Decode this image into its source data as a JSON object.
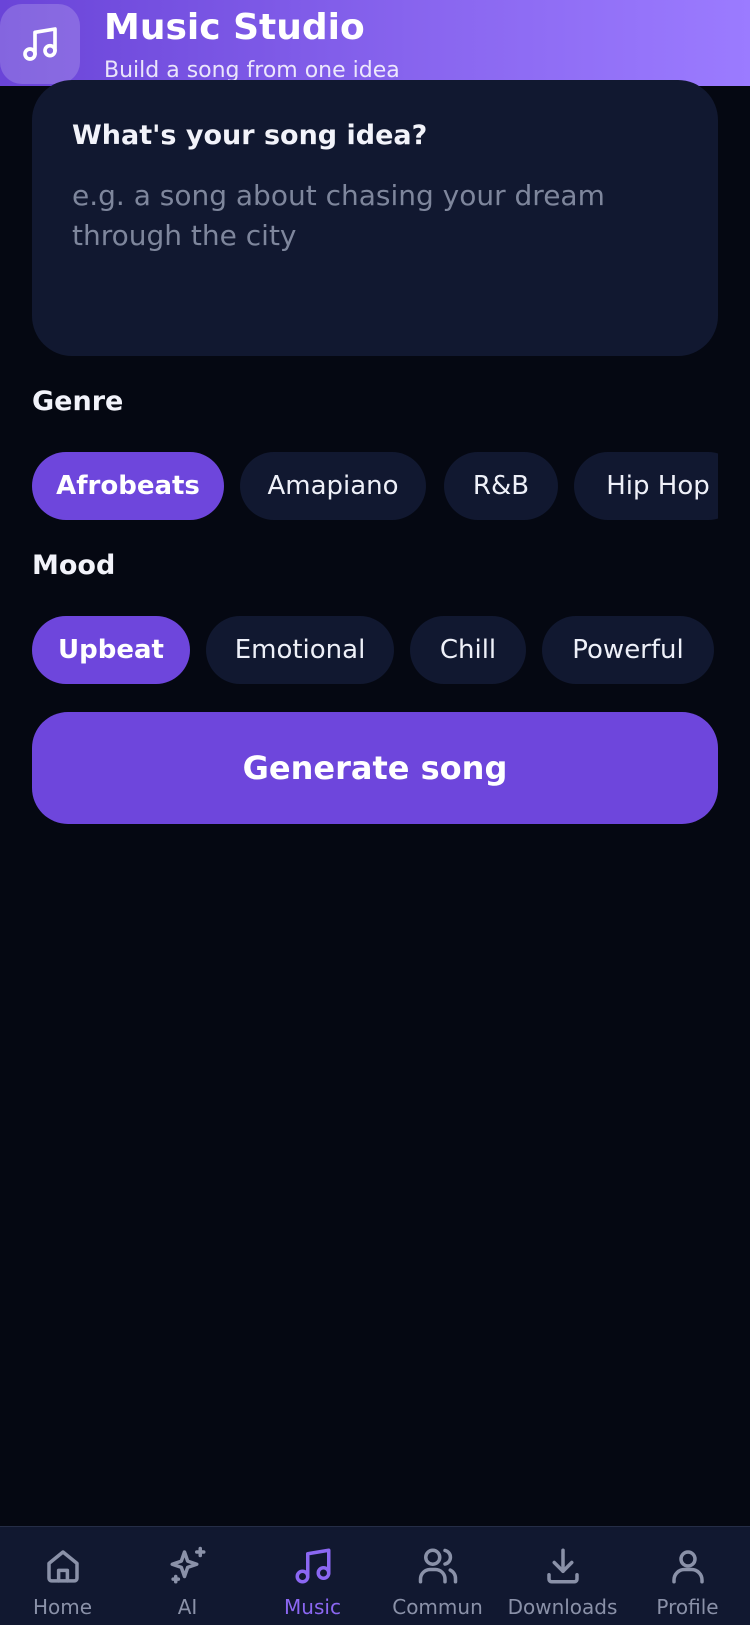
{
  "header": {
    "title": "Music Studio",
    "subtitle": "Build a song from one idea",
    "icon": "music-note-icon"
  },
  "idea": {
    "label": "What's your song idea?",
    "value": "",
    "placeholder": "e.g. a song about chasing your dream through the city"
  },
  "genre": {
    "label": "Genre",
    "options": [
      {
        "label": "Afrobeats",
        "selected": true
      },
      {
        "label": "Amapiano",
        "selected": false
      },
      {
        "label": "R&B",
        "selected": false
      },
      {
        "label": "Hip Hop",
        "selected": false
      }
    ]
  },
  "mood": {
    "label": "Mood",
    "options": [
      {
        "label": "Upbeat",
        "selected": true
      },
      {
        "label": "Emotional",
        "selected": false
      },
      {
        "label": "Chill",
        "selected": false
      },
      {
        "label": "Powerful",
        "selected": false
      }
    ]
  },
  "generate_label": "Generate song",
  "nav": {
    "active": "Music",
    "items": [
      {
        "label": "Home",
        "icon": "home-icon"
      },
      {
        "label": "AI",
        "icon": "sparkles-icon"
      },
      {
        "label": "Music",
        "icon": "music-note-icon"
      },
      {
        "label": "Commun",
        "icon": "users-icon"
      },
      {
        "label": "Downloads",
        "icon": "download-icon"
      },
      {
        "label": "Profile",
        "icon": "user-icon"
      }
    ]
  },
  "colors": {
    "accent": "#6e46dc",
    "background": "#050812",
    "surface": "#111830",
    "nav_active": "#8b67f2",
    "nav_inactive": "#8a91a8"
  }
}
